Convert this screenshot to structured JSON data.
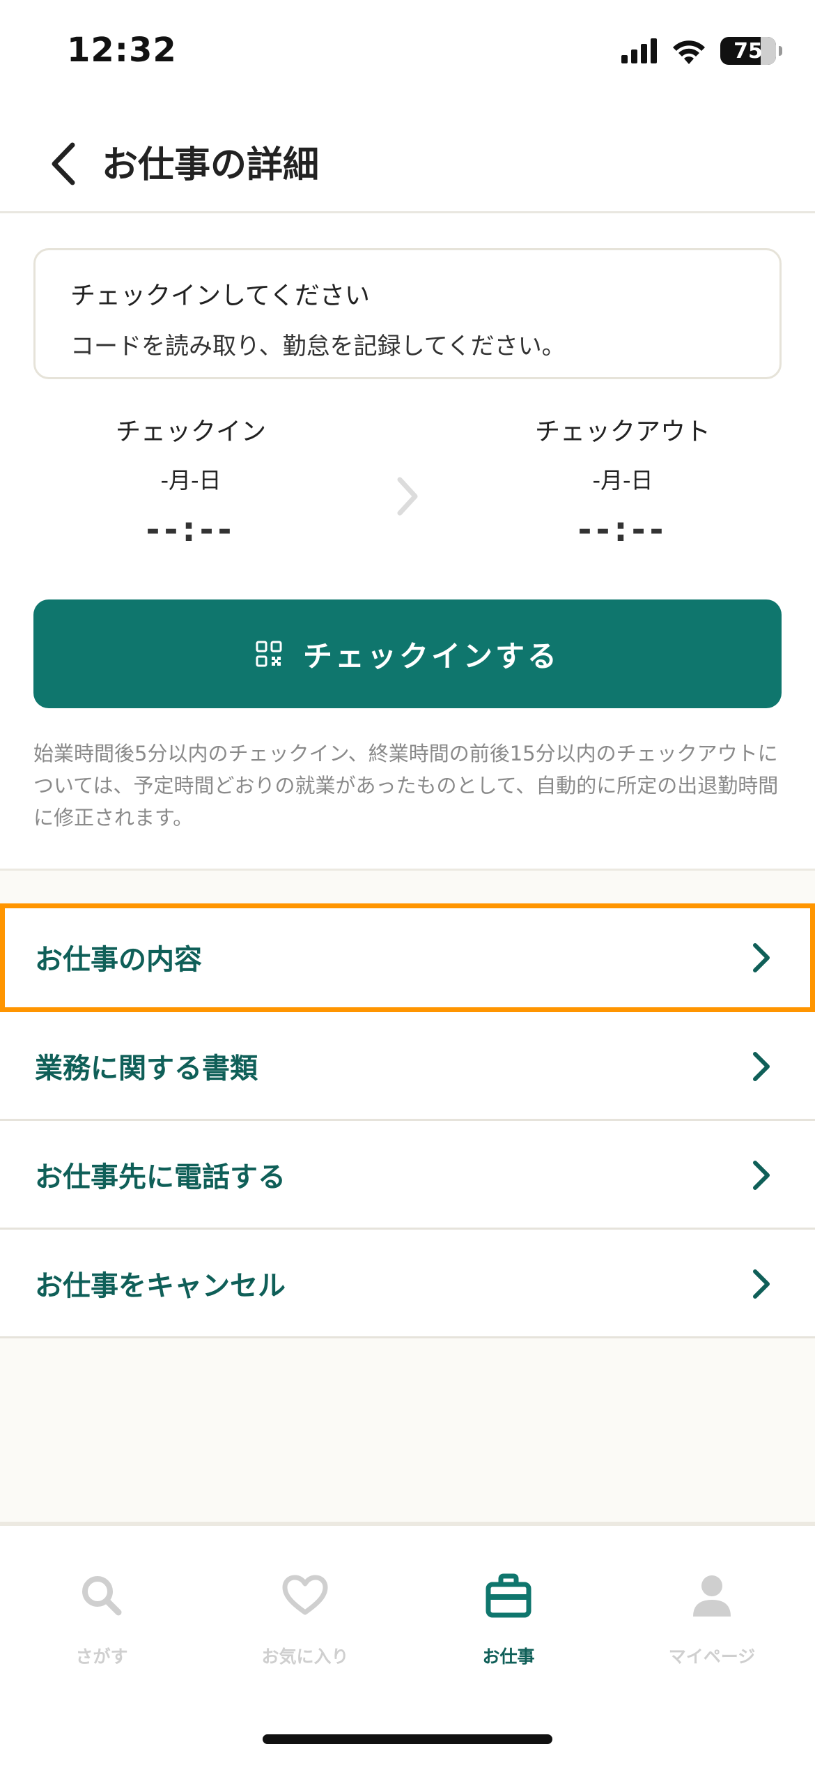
{
  "status_bar": {
    "time": "12:32",
    "battery": "75"
  },
  "header": {
    "title": "お仕事の詳細"
  },
  "notice": {
    "title": "チェックインしてください",
    "text": "コードを読み取り、勤怠を記録してください。"
  },
  "checkin": {
    "label": "チェックイン",
    "date": "-月-日",
    "time": "--:--"
  },
  "checkout": {
    "label": "チェックアウト",
    "date": "-月-日",
    "time": "--:--"
  },
  "checkin_button": {
    "label": "チェックインする"
  },
  "note": "始業時間後5分以内のチェックイン、終業時間の前後15分以内のチェックアウトについては、予定時間どおりの就業があったものとして、自動的に所定の出退勤時間に修正されます。",
  "menu": [
    {
      "label": "お仕事の内容"
    },
    {
      "label": "業務に関する書類"
    },
    {
      "label": "お仕事先に電話する"
    },
    {
      "label": "お仕事をキャンセル"
    }
  ],
  "tabs": [
    {
      "label": "さがす",
      "icon": "search-icon"
    },
    {
      "label": "お気に入り",
      "icon": "heart-icon"
    },
    {
      "label": "お仕事",
      "icon": "briefcase-icon"
    },
    {
      "label": "マイページ",
      "icon": "person-icon"
    }
  ],
  "colors": {
    "accent": "#0f766d",
    "text_accent": "#0f5f58",
    "highlight": "#ff9500"
  }
}
